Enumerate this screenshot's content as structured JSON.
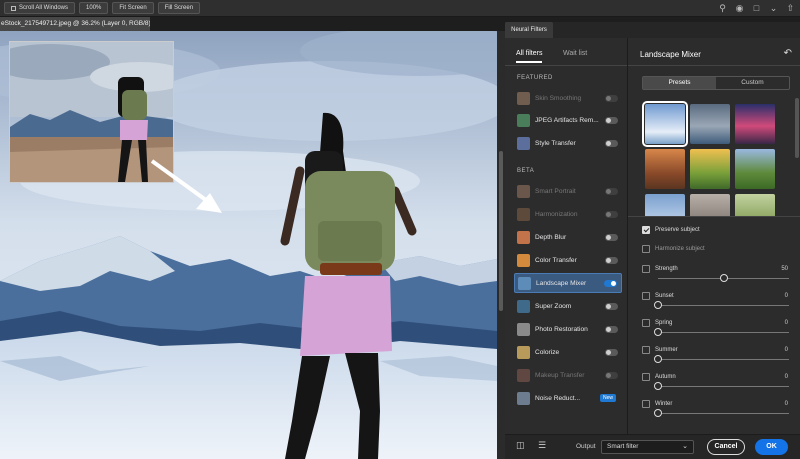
{
  "topbar": {
    "scroll_all_windows": "Scroll All Windows",
    "zoom_100": "100%",
    "fit_screen": "Fit Screen",
    "fill_screen": "Fill Screen"
  },
  "document": {
    "tab_title": "eStock_217549712.jpeg @ 36.2% (Layer 0, RGB/8) *"
  },
  "panel": {
    "tab_title": "Neural Filters"
  },
  "filters_list": {
    "tabs": [
      {
        "label": "All filters",
        "active": true
      },
      {
        "label": "Wait list",
        "active": false
      }
    ],
    "sections": {
      "featured": "FEATURED",
      "beta": "BETA"
    },
    "featured": [
      {
        "label": "Skin Smoothing",
        "enabled": false,
        "on": false
      },
      {
        "label": "JPEG Artifacts Rem...",
        "enabled": true,
        "on": false
      },
      {
        "label": "Style Transfer",
        "enabled": true,
        "on": false
      }
    ],
    "beta": [
      {
        "label": "Smart Portrait",
        "enabled": false,
        "on": false
      },
      {
        "label": "Harmonization",
        "enabled": false,
        "on": false
      },
      {
        "label": "Depth Blur",
        "enabled": true,
        "on": false
      },
      {
        "label": "Color Transfer",
        "enabled": true,
        "on": false
      },
      {
        "label": "Landscape Mixer",
        "enabled": true,
        "on": true,
        "selected": true
      },
      {
        "label": "Super Zoom",
        "enabled": true,
        "on": false
      },
      {
        "label": "Photo Restoration",
        "enabled": true,
        "on": false
      },
      {
        "label": "Colorize",
        "enabled": true,
        "on": false
      },
      {
        "label": "Makeup Transfer",
        "enabled": false,
        "on": false
      },
      {
        "label": "Noise Reduct...",
        "enabled": true,
        "on": false,
        "badge": "New"
      }
    ]
  },
  "settings": {
    "title": "Landscape Mixer",
    "segments": [
      "Presets",
      "Custom"
    ],
    "active_segment": "Presets",
    "preserve_subject": {
      "label": "Preserve subject",
      "checked": true
    },
    "harmonize_subject": {
      "label": "Harmonize subject",
      "checked": false
    },
    "sliders": [
      {
        "label": "Strength",
        "value": 50,
        "shown_value": "50",
        "max": 100
      },
      {
        "label": "Sunset",
        "value": 0,
        "shown_value": "0",
        "max": 100
      },
      {
        "label": "Spring",
        "value": 0,
        "shown_value": "0",
        "max": 100
      },
      {
        "label": "Summer",
        "value": 0,
        "shown_value": "0",
        "max": 100
      },
      {
        "label": "Autumn",
        "value": 0,
        "shown_value": "0",
        "max": 100
      },
      {
        "label": "Winter",
        "value": 0,
        "shown_value": "0",
        "max": 100
      }
    ]
  },
  "bottom": {
    "output_label": "Output",
    "output_value": "Smart filter",
    "cancel": "Cancel",
    "ok": "OK"
  },
  "colors": {
    "accent": "#1473e6",
    "selected_row": "#3b5a80"
  }
}
